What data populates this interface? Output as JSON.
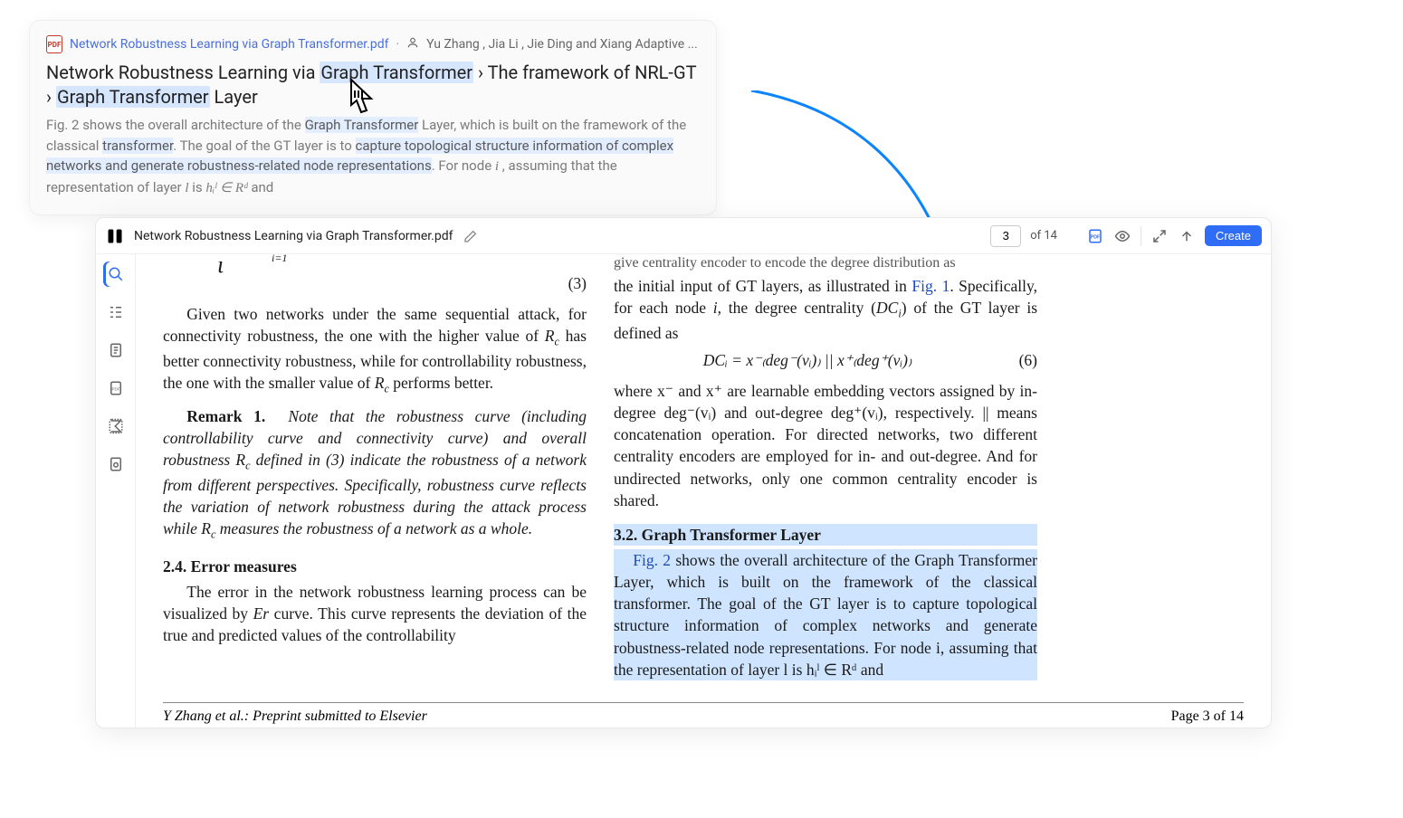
{
  "card": {
    "filename": "Network Robustness Learning via Graph Transformer.pdf",
    "authors": "Yu Zhang , Jia Li , Jie Ding and Xiang Adaptive ...",
    "path_part1": "Network Robustness Learning via ",
    "path_hl1": "Graph Transformer",
    "path_sep1": " › ",
    "path_part2": "The framework of NRL-GT",
    "path_sep2": " › ",
    "path_hl2": "Graph Transformer",
    "path_part3": " Layer",
    "snip_a": "Fig. 2 shows the overall architecture of the ",
    "snip_hl1": "Graph Transformer",
    "snip_b": " Layer, which is built on the framework of the classical ",
    "snip_hl2": "transformer",
    "snip_c": ". The goal of the GT layer is to ",
    "snip_hl3": "capture topological structure information of complex networks and generate robustness-related node representations",
    "snip_d": ". For node ",
    "snip_var_i": "i",
    "snip_e": " , assuming that the representation of layer ",
    "snip_var_l": "l",
    "snip_f": " is ",
    "snip_math": "hᵢˡ ∈ Rᵈ",
    "snip_g": " and"
  },
  "toolbar": {
    "filename": "Network Robustness Learning via Graph Transformer.pdf",
    "page": "3",
    "of": "of 14",
    "create": "Create"
  },
  "paper": {
    "eq3_num": "(3)",
    "left1": "Given two networks under the same sequential attack, for connectivity robustness, the one with the higher value of ",
    "left1_rc": "R",
    "left1b": " has better connectivity robustness, while for controllability robustness, the one with the smaller value of ",
    "left1c": " performs better.",
    "remark_label": "Remark 1.",
    "remark_body": "Note that the robustness curve (including controllability curve and connectivity curve) and overall robustness R",
    "remark_body2": " defined in (3) indicate the robustness of a network from different perspectives. Specifically, robustness curve reflects the variation of network robustness during the attack process while R",
    "remark_body3": " measures the robustness of a network as a whole.",
    "sec24": "2.4.  Error measures",
    "left2": "The error in the network robustness learning process can be visualized by ",
    "left2_er": "Er",
    "left2b": " curve. This curve represents the deviation of the true and predicted values of the controllability",
    "right_pre_a": "give centrality encoder to encode the degree distribution as",
    "right_pre_b": "the initial input of GT layers, as illustrated in ",
    "right_fig1": "Fig. 1",
    "right_pre_c": ". Specifically, for each node ",
    "right_pre_d": ", the degree centrality (",
    "right_pre_e": ") of the GT layer is defined as",
    "eq6": "DCᵢ = x⁻₍deg⁻(vᵢ)₎ || x⁺₍deg⁺(vᵢ)₎",
    "eq6_num": "(6)",
    "right_where": "where x⁻ and x⁺ are learnable embedding vectors assigned by in-degree deg⁻(vᵢ) and out-degree deg⁺(vᵢ), respectively. || means concatenation operation. For directed networks, two different centrality encoders are employed for in- and out-degree. And for undirected networks, only one common centrality encoder is shared.",
    "sec32": "3.2.  Graph Transformer Layer",
    "right_hl_a": "Fig. 2",
    "right_hl_b": " shows the overall architecture of the Graph Transformer Layer, which is built on the framework of the classical transformer. The goal of the GT layer is to capture topological structure information of complex networks and generate robustness-related node representations. For node i, assuming that the representation of layer l is hᵢˡ ∈ Rᵈ and",
    "footer_left": "Y Zhang et al.: Preprint submitted to Elsevier",
    "footer_right": "Page 3 of 14"
  }
}
